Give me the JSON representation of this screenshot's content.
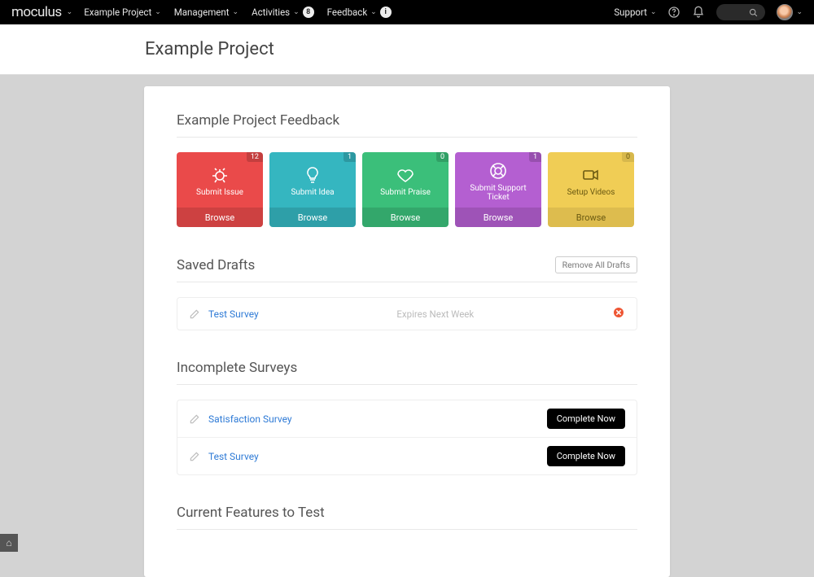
{
  "nav": {
    "logo": "moculus",
    "items": [
      {
        "label": "Example Project",
        "badge": null,
        "info": false
      },
      {
        "label": "Management",
        "badge": null,
        "info": false
      },
      {
        "label": "Activities",
        "badge": "8",
        "info": false
      },
      {
        "label": "Feedback",
        "badge": null,
        "info": true
      }
    ],
    "support": "Support"
  },
  "page_title": "Example Project",
  "feedback": {
    "heading": "Example Project Feedback",
    "tiles": [
      {
        "label": "Submit Issue",
        "count": "12",
        "browse": "Browse",
        "color": "t-red",
        "icon": "bug"
      },
      {
        "label": "Submit Idea",
        "count": "1",
        "browse": "Browse",
        "color": "t-teal",
        "icon": "bulb"
      },
      {
        "label": "Submit Praise",
        "count": "0",
        "browse": "Browse",
        "color": "t-green",
        "icon": "heart"
      },
      {
        "label": "Submit Support Ticket",
        "count": "1",
        "browse": "Browse",
        "color": "t-purple",
        "icon": "lifebuoy"
      },
      {
        "label": "Setup Videos",
        "count": "0",
        "browse": "Browse",
        "color": "t-yellow",
        "icon": "video"
      }
    ]
  },
  "drafts": {
    "heading": "Saved Drafts",
    "remove_all": "Remove All Drafts",
    "rows": [
      {
        "title": "Test Survey",
        "note": "Expires Next Week"
      }
    ]
  },
  "incomplete": {
    "heading": "Incomplete Surveys",
    "action": "Complete Now",
    "rows": [
      {
        "title": "Satisfaction Survey"
      },
      {
        "title": "Test Survey"
      }
    ]
  },
  "current_features_heading": "Current Features to Test"
}
